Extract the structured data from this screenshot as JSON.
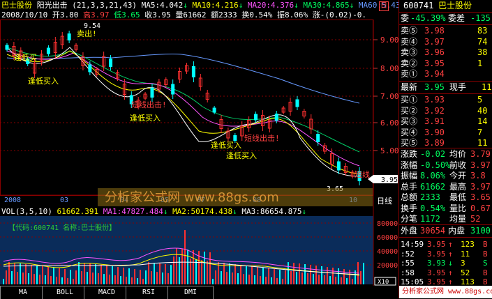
{
  "header": {
    "name": "巴士股份",
    "indicator": "阳光出击",
    "params": "(21,3,3,21,43)",
    "ma5": "MA5:4.042",
    "ma10": "MA10:4.216",
    "ma20": "MA20:4.376",
    "ma30": "MA30:4.865",
    "ma60": "MA60:5.43",
    "arrow": "↓",
    "box": "日"
  },
  "row2": {
    "date": "2008/10/10",
    "open": "开3.80",
    "high": "高3.97",
    "low": "低3.65",
    "close": "收3.95",
    "vol": "量61662",
    "amount": "额2333",
    "turnover": "换0.54%",
    "amplitude": "振8.06%",
    "change": "涨-(0.02)-0."
  },
  "price_axis": [
    "9.00",
    "8.00",
    "7.00",
    "6.00",
    "5.00"
  ],
  "price_tag": "3.95",
  "annotations": {
    "high_val": "9.54",
    "sell_top": "卖出!",
    "low_entry1": "逢低买",
    "low_entry2": "逢低买入",
    "short_out1": "短线出击!",
    "low_entry3": "逢低买入",
    "short_out2": "短线出击!",
    "low_entry4": "逢低买入",
    "low_entry5": "逢低买入",
    "short_line": "短线",
    "low_val": "3.65"
  },
  "date_axis": [
    "2008",
    "03",
    "04",
    "05",
    "07",
    "08",
    "10"
  ],
  "date_label": "日线",
  "watermark": "分析家公式网 www.88gs.com",
  "vol_header": {
    "name": "VOL(3,5,10)",
    "val": "61662.391",
    "ma1": "MA1:47827.484",
    "ma2": "MA2:50174.438",
    "ma3": "MA3:86654.875"
  },
  "vol_axis": [
    "80000",
    "60000",
    "40000",
    "20000"
  ],
  "vol_info": "【代码:600741 名称:巴士股份】",
  "vol_scale": "X10",
  "tabs": [
    "MA",
    "BOLL",
    "MACD",
    "RSI",
    "DMI"
  ],
  "right": {
    "code": "600741",
    "name": "巴士股份",
    "weibi_label": "委",
    "weibi": "-45.39%",
    "weicha_label": "委差",
    "weicha": "-135",
    "sells": [
      {
        "label": "卖⑤",
        "price": "3.98",
        "vol": "83"
      },
      {
        "label": "卖④",
        "price": "3.97",
        "vol": "74"
      },
      {
        "label": "卖③",
        "price": "3.96",
        "vol": "38"
      },
      {
        "label": "卖②",
        "price": "3.95",
        "vol": "1"
      },
      {
        "label": "卖①",
        "price": "3.94",
        "vol": ""
      }
    ],
    "latest_label": "最新",
    "latest": "3.95",
    "hand_label": "现手",
    "hand": "11",
    "buys": [
      {
        "label": "买①",
        "price": "3.93",
        "vol": "5"
      },
      {
        "label": "买②",
        "price": "3.92",
        "vol": "40"
      },
      {
        "label": "买③",
        "price": "3.91",
        "vol": "14"
      },
      {
        "label": "买④",
        "price": "3.90",
        "vol": "7"
      },
      {
        "label": "买⑤",
        "price": "3.89",
        "vol": "11"
      }
    ],
    "stats": [
      {
        "l1": "涨跌",
        "v1": "-0.02",
        "l2": "均价",
        "v2": "3.79"
      },
      {
        "l1": "涨幅",
        "v1": "-0.50%",
        "l2": "前收",
        "v2": "3.97"
      },
      {
        "l1": "振幅",
        "v1": "8.06%",
        "l2": "今开",
        "v2": "3.8"
      },
      {
        "l1": "总手",
        "v1": "61662",
        "l2": "最高",
        "v2": "3.97"
      },
      {
        "l1": "总额",
        "v1": "2333",
        "l2": "最低",
        "v2": "3.65"
      },
      {
        "l1": "换手",
        "v1": "0.54%",
        "l2": "量比",
        "v2": "0.67"
      },
      {
        "l1": "分笔",
        "v1": "1172",
        "l2": "均量",
        "v2": "52"
      }
    ],
    "outer_label": "外盘",
    "outer": "30654",
    "inner_label": "内盘",
    "inner": "3100",
    "ticks": [
      {
        "time": "14:59",
        "price": "3.95",
        "dir": "↑",
        "vol": "123",
        "side": "B"
      },
      {
        "time": ":52",
        "price": "3.95",
        "dir": "↑",
        "vol": "11",
        "side": "B"
      },
      {
        "time": ":55",
        "price": "3.93",
        "dir": "↓",
        "vol": "3",
        "side": "S"
      },
      {
        "time": ":58",
        "price": "3.95",
        "dir": "↑",
        "vol": "52",
        "side": "B"
      },
      {
        "time": "15:05",
        "price": "3.95",
        "dir": "↑",
        "vol": "113",
        "side": "B"
      }
    ],
    "footer": "分析家公式网 www.88gs.com"
  }
}
